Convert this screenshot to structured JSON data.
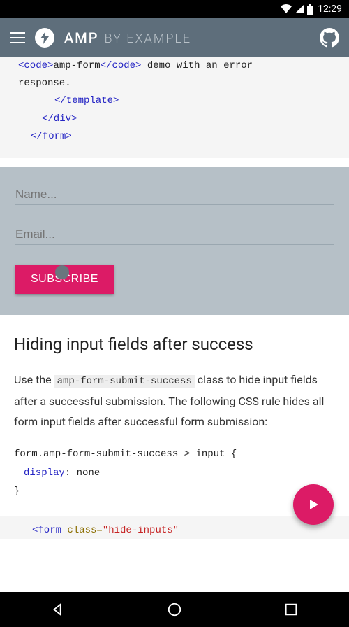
{
  "statusbar": {
    "time": "12:29"
  },
  "header": {
    "brand_main": "AMP",
    "brand_sub": "BY EXAMPLE"
  },
  "code_top": {
    "l1a": "<code>",
    "l1b": "amp-form",
    "l1c": "</code>",
    "l1d": " demo with an error",
    "l2": "response.",
    "l3": "</template>",
    "l4": "</div>",
    "l5": "</form>"
  },
  "form": {
    "name_placeholder": "Name...",
    "email_placeholder": "Email...",
    "subscribe_label": "SUBSCRIBE"
  },
  "article": {
    "heading": "Hiding input fields after success",
    "p_a": "Use the ",
    "p_code": "amp-form-submit-success",
    "p_b": " class to hide input fields after a successful submission. The following CSS rule hides all form input fields after successful form submission:"
  },
  "css": {
    "l1": "form.amp-form-submit-success > input {",
    "l2a": "display",
    "l2b": ": none",
    "l3": "}"
  },
  "code_bottom": {
    "open": "<form",
    "attr": " class=",
    "val": "\"hide-inputs\""
  }
}
